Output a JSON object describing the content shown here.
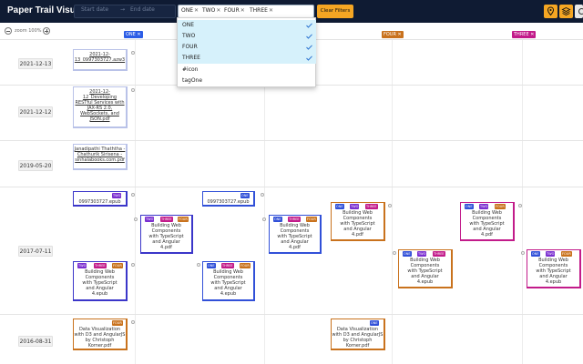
{
  "app_title": "Paper Trail Visualizer",
  "filters": {
    "start_date_placeholder": "Start date",
    "end_date_placeholder": "End date",
    "arrow": "→",
    "selected_tags": [
      "ONE",
      "TWO",
      "FOUR",
      "THREE"
    ],
    "clear_label": "Clear Filters"
  },
  "toolbar": {
    "icon1": "pin-icon",
    "icon2": "layers-icon",
    "icon3": "settings-icon"
  },
  "zoom": {
    "label": "zoom 100%"
  },
  "column_tags": [
    {
      "label": "ONE ✕",
      "color": "#2c5de6"
    },
    {
      "label": "FOUR ✕",
      "color": "#c9721d"
    },
    {
      "label": "THREE ✕",
      "color": "#c21b8a"
    }
  ],
  "dropdown": {
    "items": [
      {
        "label": "ONE",
        "selected": true
      },
      {
        "label": "TWO",
        "selected": true
      },
      {
        "label": "FOUR",
        "selected": true
      },
      {
        "label": "THREE",
        "selected": true
      },
      {
        "label": "#icon",
        "selected": false
      },
      {
        "label": "tagOne",
        "selected": false
      }
    ]
  },
  "dates": [
    "2021-12-13",
    "2021-12-12",
    "2019-05-20",
    "2017-07-11",
    "2016-08-31"
  ],
  "tag_colors": {
    "ONE": "#3150d8",
    "TWO": "#7b2fd0",
    "FOUR": "#c9721d",
    "THREE": "#c21b8a"
  },
  "cards": {
    "c1": {
      "text": "2021-12-13_0997303727.azw3"
    },
    "c2": {
      "text": "2021-12-12_Developing RESTful Services with JAX-RS 2.0, WebSockets, and JSON.pdf"
    },
    "c3": {
      "text": "Janadipathi Thaththa - Chathurik Sirisena - sinhalabooks.com.pdf"
    },
    "c4": {
      "text": "0997303727.epub",
      "tags": [
        "TWO"
      ]
    },
    "c5": {
      "text": "Building Web Components with TypeScript and Angular 4.pdf",
      "tags": [
        "TWO",
        "THREE",
        "FOUR"
      ]
    },
    "c6": {
      "text": "Building Web Components with TypeScript and Angular 4.epub",
      "tags": [
        "TWO",
        "THREE",
        "FOUR"
      ]
    },
    "c7": {
      "text": "0997303727.epub",
      "tags": [
        "ONE"
      ]
    },
    "c8": {
      "text": "Building Web Components with TypeScript and Angular 4.epub",
      "tags": [
        "ONE",
        "THREE",
        "FOUR"
      ]
    },
    "c9": {
      "text": "Building Web Components with TypeScript and Angular 4.pdf",
      "tags": [
        "ONE",
        "THREE",
        "FOUR"
      ]
    },
    "c10": {
      "text": "Building Web Components with TypeScript and Angular 4.pdf",
      "tags": [
        "ONE",
        "TWO",
        "THREE"
      ]
    },
    "c11": {
      "text": "Building Web Components with TypeScript and Angular 4.epub",
      "tags": [
        "ONE",
        "TWO",
        "THREE"
      ]
    },
    "c12": {
      "text": "Building Web Components with TypeScript and Angular 4.pdf",
      "tags": [
        "ONE",
        "TWO",
        "FOUR"
      ]
    },
    "c13": {
      "text": "Building Web Components with TypeScript and Angular 4.epub",
      "tags": [
        "ONE",
        "TWO",
        "FOUR"
      ]
    },
    "c14": {
      "text": "Data Visualization with D3 and AngularJS by Christoph Korner.pdf",
      "tags": [
        "FOUR"
      ]
    },
    "c15": {
      "text": "Data Visualization with D3 and AngularJS by Christoph Korner.pdf",
      "tags": [
        "ONE"
      ]
    }
  }
}
